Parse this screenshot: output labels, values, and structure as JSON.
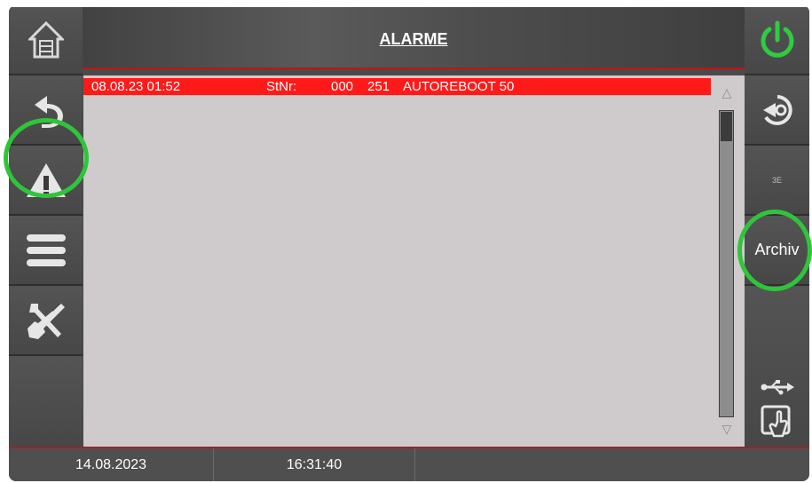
{
  "header": {
    "title": "ALARME"
  },
  "sidebar_left": {
    "items": [
      {
        "name": "home-icon"
      },
      {
        "name": "back-icon"
      },
      {
        "name": "alarm-warning-icon"
      },
      {
        "name": "menu-icon"
      },
      {
        "name": "tools-icon"
      }
    ]
  },
  "sidebar_right": {
    "power_icon": "power-icon",
    "login_icon": "login-icon",
    "small_label": "3E",
    "archive_label": "Archiv",
    "usb_icon": "usb-icon",
    "touch_icon": "touch-icon"
  },
  "alarm_list": {
    "rows": [
      {
        "datetime": "08.08.23 01:52",
        "stnr_label": "StNr:",
        "code1": "000",
        "code2": "251",
        "message": "AUTOREBOOT 50"
      }
    ]
  },
  "scrollbar": {
    "up": "△",
    "down": "▽"
  },
  "footer": {
    "date": "14.08.2023",
    "time": "16:31:40"
  },
  "colors": {
    "alarm_red": "#ff1a1a",
    "highlight_green": "#2fc53b",
    "accent_red": "#b11a1a",
    "power_green": "#2ecc40"
  }
}
